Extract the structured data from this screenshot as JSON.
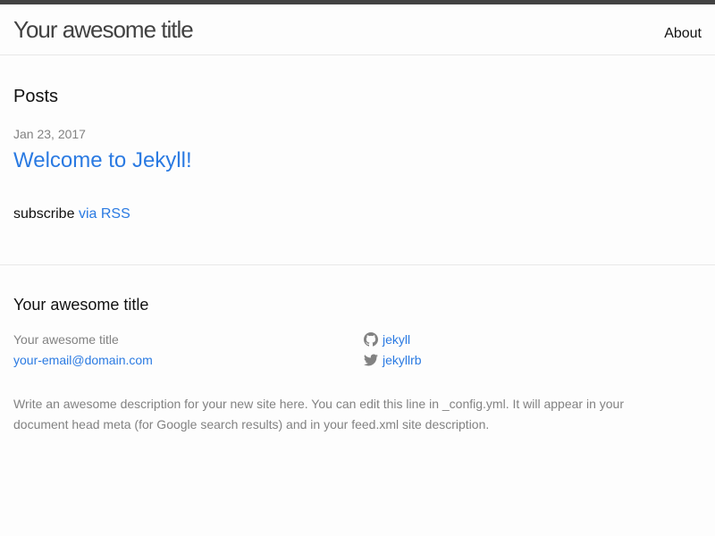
{
  "header": {
    "site_title": "Your awesome title",
    "nav": {
      "about": "About"
    }
  },
  "main": {
    "posts_heading": "Posts",
    "posts": [
      {
        "date": "Jan 23, 2017",
        "title": "Welcome to Jekyll!"
      }
    ],
    "rss": {
      "prefix": "subscribe",
      "link_label": "via RSS"
    }
  },
  "footer": {
    "heading": "Your awesome title",
    "name": "Your awesome title",
    "email": "your-email@domain.com",
    "github": {
      "username": "jekyll",
      "icon": "github-icon"
    },
    "twitter": {
      "username": "jekyllrb",
      "icon": "twitter-icon"
    },
    "description": "Write an awesome description for your new site here. You can edit this line in _config.yml. It will appear in your document head meta (for Google search results) and in your feed.xml site description."
  },
  "colors": {
    "accent": "#2a7ae2",
    "muted": "#828282",
    "text": "#111111",
    "topbar": "#424242",
    "divider": "#e8e8e8",
    "background": "#fdfdfd"
  }
}
